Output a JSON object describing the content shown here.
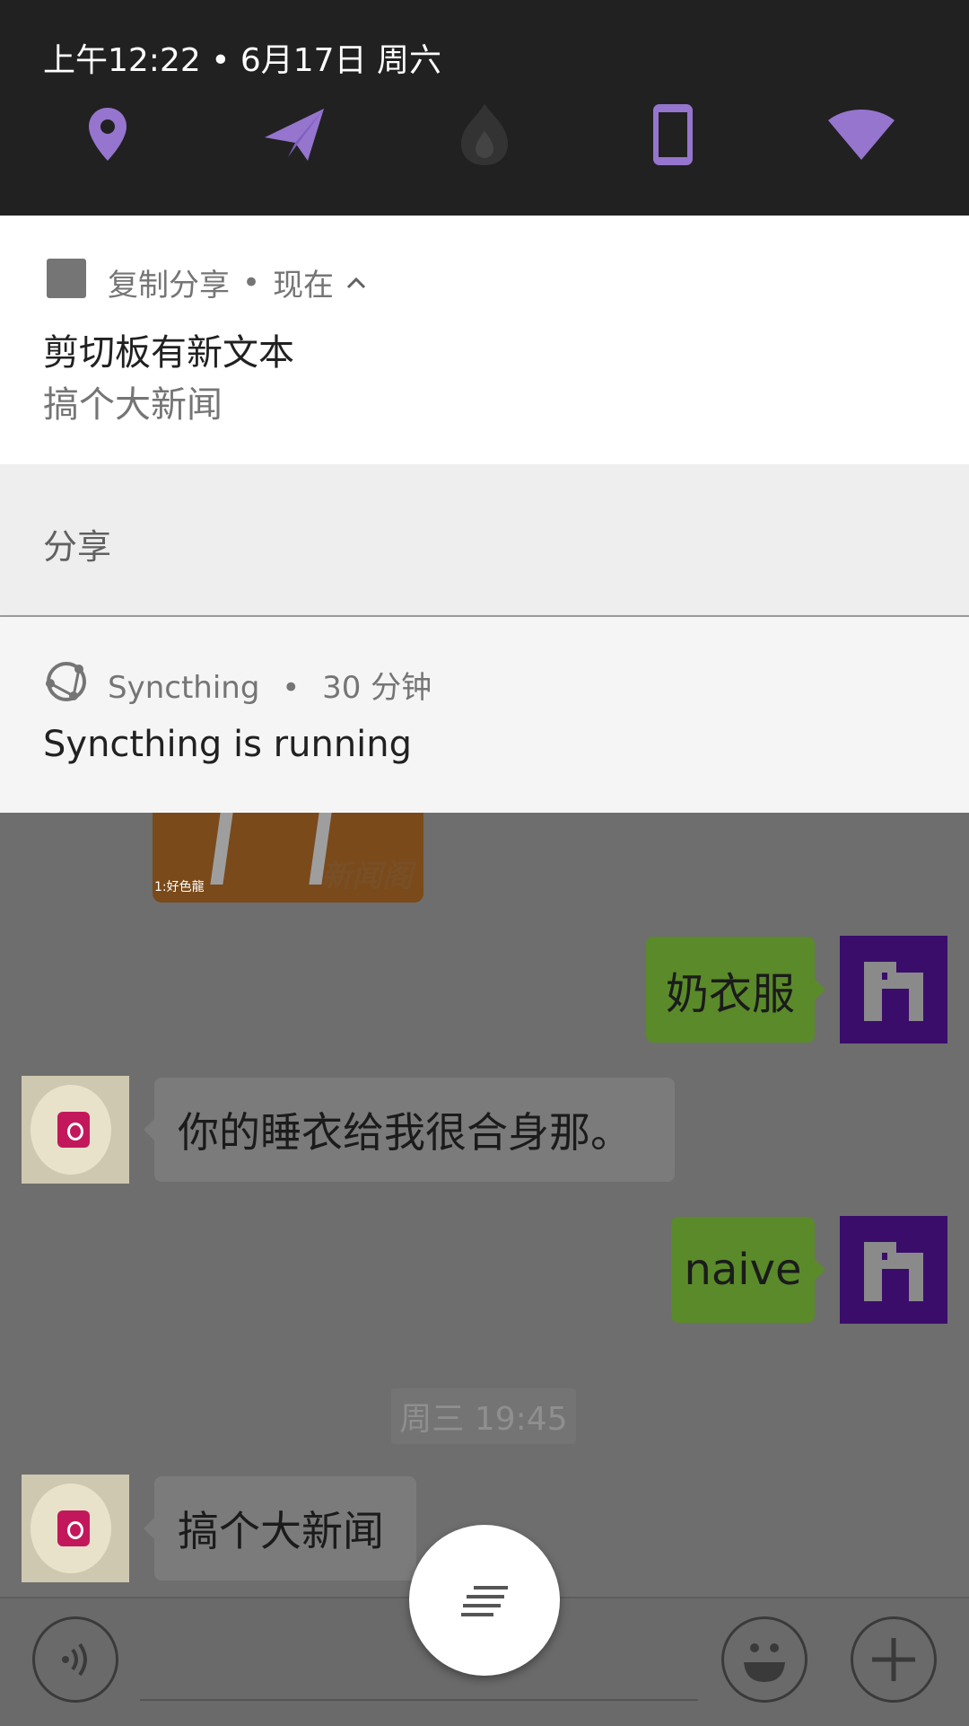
{
  "status": {
    "datetime": "上午12:22 • 6月17日 周六",
    "icons": [
      "location-icon",
      "send-icon",
      "flame-icon",
      "phone-icon",
      "wifi-icon"
    ],
    "accent": "#9575cd"
  },
  "notification_clipboard": {
    "app": "复制分享",
    "time": "现在",
    "title": "剪切板有新文本",
    "text": "搞个大新闻",
    "action": "分享"
  },
  "notification_syncthing": {
    "app": "Syncthing",
    "time": "30 分钟",
    "title": "Syncthing is running"
  },
  "chat": {
    "image_watermark": "新闻阁",
    "image_caption": "1:好色龍",
    "messages": [
      {
        "side": "right",
        "text": "奶衣服"
      },
      {
        "side": "left",
        "text": "你的睡衣给我很合身那。"
      },
      {
        "side": "right",
        "text": "naive"
      },
      {
        "side": "left",
        "text": "搞个大新闻"
      }
    ],
    "timestamp": "周三 19:45"
  },
  "input_bar": {
    "voice_icon": "voice-icon",
    "emoji_icon": "emoji-icon",
    "add_icon": "add-icon",
    "fab_icon": "menu-lines-icon"
  }
}
